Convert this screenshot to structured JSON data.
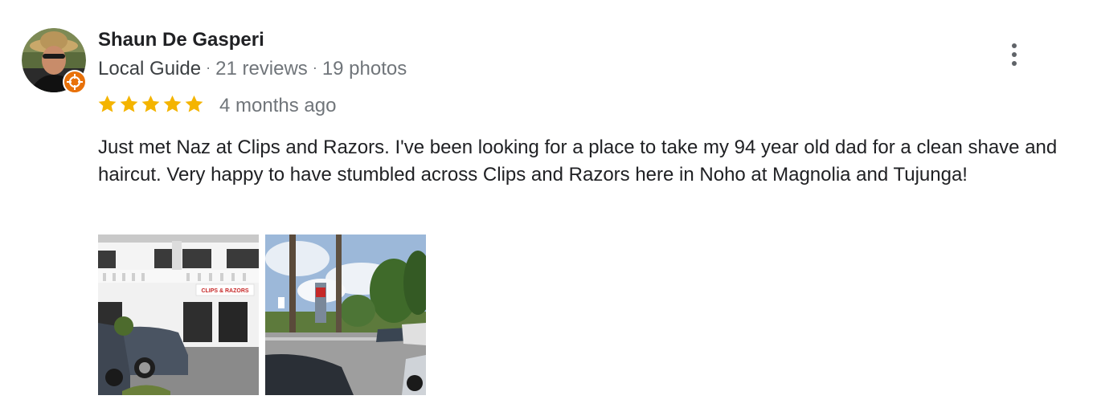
{
  "review": {
    "reviewer_name": "Shaun De Gasperi",
    "guide_label": "Local Guide",
    "separator": "·",
    "reviews_count": "21 reviews",
    "photos_count": "19 photos",
    "rating": 5,
    "rating_max": 5,
    "star_color": "#f4b400",
    "date": "4 months ago",
    "text": "Just met Naz at Clips and Razors. I've been looking for a place to take my 94 year old dad for a clean shave and haircut. Very happy to have stumbled across Clips and Razors here in Noho at Magnolia and Tujunga!",
    "badge_color": "#e8710a",
    "photos": [
      {
        "icon": "storefront-photo",
        "sign_text": "CLIPS & RAZORS"
      },
      {
        "icon": "street-palm-trees-photo"
      }
    ]
  },
  "menu": {
    "icon": "more-vert-icon"
  }
}
